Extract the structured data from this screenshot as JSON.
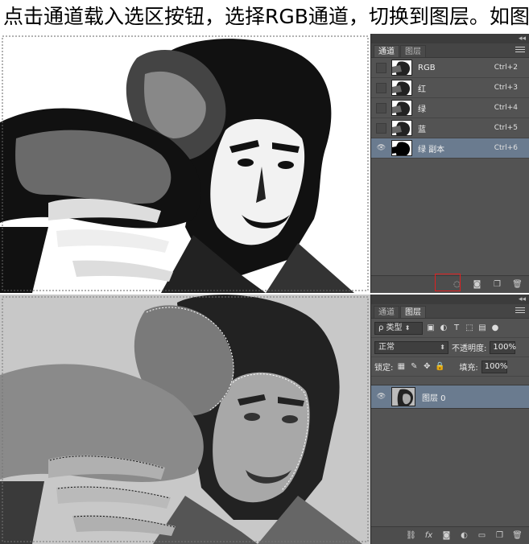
{
  "caption": "点击通道载入选区按钮，选择RGB通道，切换到图层。如图。",
  "top": {
    "panel_tabs": [
      "通道",
      "图层"
    ],
    "active_tab": 0,
    "channels": [
      {
        "label": "RGB",
        "shortcut": "Ctrl+2",
        "visible": false,
        "selected": false
      },
      {
        "label": "红",
        "shortcut": "Ctrl+3",
        "visible": false,
        "selected": false
      },
      {
        "label": "绿",
        "shortcut": "Ctrl+4",
        "visible": false,
        "selected": false
      },
      {
        "label": "蓝",
        "shortcut": "Ctrl+5",
        "visible": false,
        "selected": false
      },
      {
        "label": "绿 副本",
        "shortcut": "Ctrl+6",
        "visible": true,
        "selected": true
      }
    ],
    "footer_icons": [
      "load-selection-icon",
      "save-selection-icon",
      "new-channel-icon",
      "delete-icon"
    ],
    "highlight_color": "#e02020"
  },
  "bottom": {
    "panel_tabs": [
      "通道",
      "图层"
    ],
    "active_tab": 1,
    "filter_kind": "ρ 类型",
    "blend_mode": "正常",
    "opacity_label": "不透明度:",
    "opacity_value": "100%",
    "lock_label": "锁定:",
    "fill_label": "填充:",
    "fill_value": "100%",
    "layers": [
      {
        "label": "图层 0",
        "visible": true,
        "selected": true
      }
    ],
    "footer_icons": [
      "link-icon",
      "fx-icon",
      "mask-icon",
      "adjustment-icon",
      "group-icon",
      "new-layer-icon",
      "delete-icon"
    ]
  },
  "colors": {
    "panel_bg": "#535353",
    "selection": "#6a7b8f",
    "tab_bar": "#454545"
  }
}
